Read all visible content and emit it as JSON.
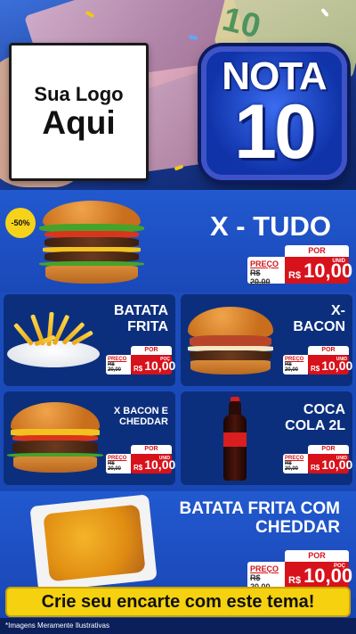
{
  "header": {
    "logo_line1": "Sua Logo",
    "logo_line2": "Aqui",
    "badge_word": "NOTA",
    "badge_number": "10"
  },
  "hero": {
    "title": "X - TUDO",
    "discount": "-50%",
    "price": {
      "por_label": "POR",
      "preco_label": "PREÇO",
      "old": "R$ 20,00",
      "currency": "R$",
      "value": "10,00",
      "unit": "UNID"
    }
  },
  "grid": [
    {
      "title": "BATATA FRITA",
      "price": {
        "por_label": "POR",
        "preco_label": "PREÇO",
        "old": "R$ 20,00",
        "currency": "R$",
        "value": "10,00",
        "unit": "POÇ"
      }
    },
    {
      "title": "X-BACON",
      "price": {
        "por_label": "POR",
        "preco_label": "PREÇO",
        "old": "R$ 20,00",
        "currency": "R$",
        "value": "10,00",
        "unit": "UNID"
      }
    },
    {
      "title": "X BACON E CHEDDAR",
      "price": {
        "por_label": "POR",
        "preco_label": "PREÇO",
        "old": "R$ 20,00",
        "currency": "R$",
        "value": "10,00",
        "unit": "UNID"
      }
    },
    {
      "title": "COCA COLA 2L",
      "price": {
        "por_label": "POR",
        "preco_label": "PREÇO",
        "old": "R$ 20,00",
        "currency": "R$",
        "value": "10,00",
        "unit": "UNID"
      }
    }
  ],
  "featured": {
    "title": "BATATA FRITA COM CHEDDAR",
    "price": {
      "por_label": "POR",
      "preco_label": "PREÇO",
      "old": "R$ 20,00",
      "currency": "R$",
      "value": "10,00",
      "unit": "POÇ"
    }
  },
  "cta": "Crie seu encarte com este tema!",
  "disclaimer": "*Imagens Meramente Ilustrativas",
  "colors": {
    "brand_blue": "#1e4fc0",
    "card_blue": "#0c2f7d",
    "price_red": "#d7121b",
    "cta_yellow": "#f5d10f"
  }
}
